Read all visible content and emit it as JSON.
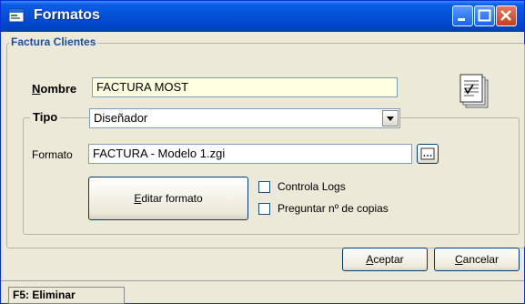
{
  "window": {
    "title": "Formatos",
    "title_icon": "form-window-icon",
    "controls": [
      "minimize",
      "maximize",
      "close"
    ]
  },
  "group_factura": {
    "label": "Factura Clientes"
  },
  "nombre": {
    "label_u": "N",
    "label_rest": "ombre",
    "value": "FACTURA MOST"
  },
  "tipo": {
    "label": "Tipo",
    "value": "Diseñador"
  },
  "formato": {
    "label": "Formato",
    "value": "FACTURA - Modelo 1.zgi"
  },
  "buttons": {
    "editar_u": "E",
    "editar_rest": "ditar formato",
    "aceptar_u": "A",
    "aceptar_rest": "ceptar",
    "cancelar_u": "C",
    "cancelar_rest": "ancelar"
  },
  "checkboxes": {
    "controla_logs": "Controla Logs",
    "preguntar_copias": "Preguntar nº de copias"
  },
  "statusbar": {
    "f5": "F5: Eliminar"
  },
  "colors": {
    "title_bar": "#0a5ce8",
    "nombre_bg": "#ffffe1",
    "window_bg": "#ece9d8",
    "group_label": "#1a4f9c"
  }
}
